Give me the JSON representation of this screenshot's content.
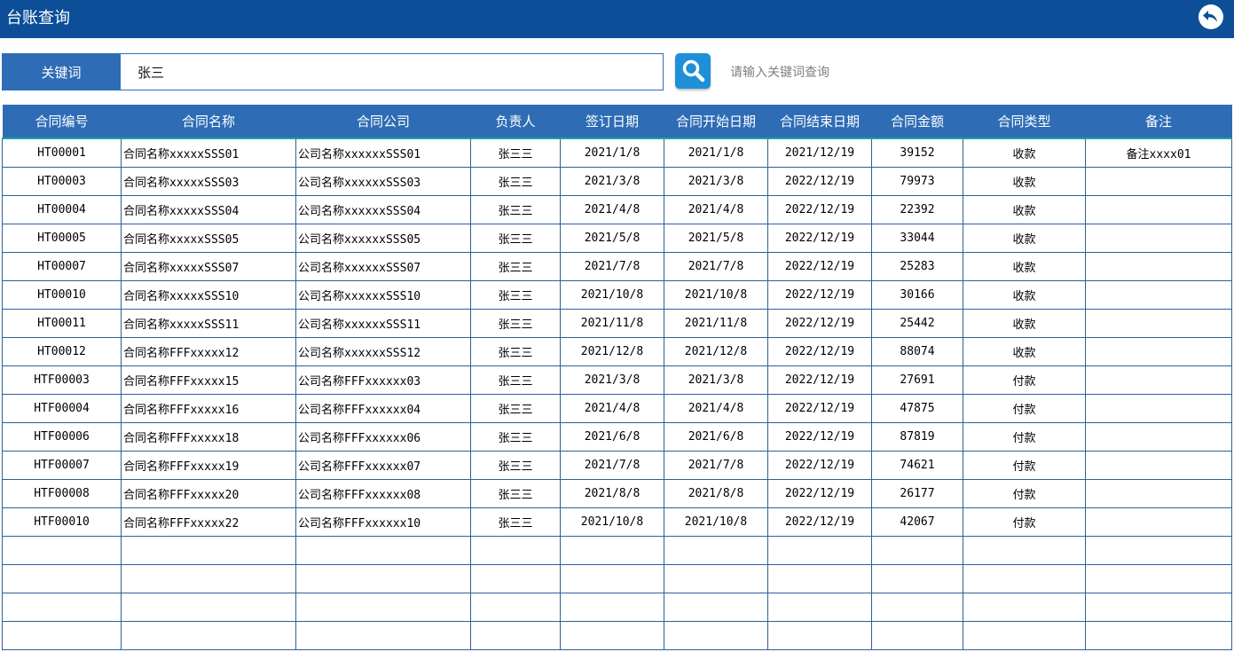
{
  "header": {
    "title": "台账查询",
    "back_icon": "back-arrow-icon"
  },
  "search": {
    "label": "关键词",
    "value": "张三",
    "hint": "请输入关键词查询",
    "button_icon": "search-icon",
    "button_color": "#1f8fd8"
  },
  "colors": {
    "header_bg": "#0c4f98",
    "table_header_bg": "#2e6db5",
    "grid_line": "#2e5f99"
  },
  "table": {
    "columns": [
      "合同编号",
      "合同名称",
      "合同公司",
      "负责人",
      "签订日期",
      "合同开始日期",
      "合同结束日期",
      "合同金额",
      "合同类型",
      "备注"
    ],
    "rows": [
      [
        "HT00001",
        "合同名称xxxxxSSS01",
        "公司名称xxxxxxSSS01",
        "张三三",
        "2021/1/8",
        "2021/1/8",
        "2021/12/19",
        "39152",
        "收款",
        "备注xxxx01"
      ],
      [
        "HT00003",
        "合同名称xxxxxSSS03",
        "公司名称xxxxxxSSS03",
        "张三三",
        "2021/3/8",
        "2021/3/8",
        "2022/12/19",
        "79973",
        "收款",
        ""
      ],
      [
        "HT00004",
        "合同名称xxxxxSSS04",
        "公司名称xxxxxxSSS04",
        "张三三",
        "2021/4/8",
        "2021/4/8",
        "2022/12/19",
        "22392",
        "收款",
        ""
      ],
      [
        "HT00005",
        "合同名称xxxxxSSS05",
        "公司名称xxxxxxSSS05",
        "张三三",
        "2021/5/8",
        "2021/5/8",
        "2022/12/19",
        "33044",
        "收款",
        ""
      ],
      [
        "HT00007",
        "合同名称xxxxxSSS07",
        "公司名称xxxxxxSSS07",
        "张三三",
        "2021/7/8",
        "2021/7/8",
        "2022/12/19",
        "25283",
        "收款",
        ""
      ],
      [
        "HT00010",
        "合同名称xxxxxSSS10",
        "公司名称xxxxxxSSS10",
        "张三三",
        "2021/10/8",
        "2021/10/8",
        "2022/12/19",
        "30166",
        "收款",
        ""
      ],
      [
        "HT00011",
        "合同名称xxxxxSSS11",
        "公司名称xxxxxxSSS11",
        "张三三",
        "2021/11/8",
        "2021/11/8",
        "2022/12/19",
        "25442",
        "收款",
        ""
      ],
      [
        "HT00012",
        "合同名称FFFxxxxx12",
        "公司名称xxxxxxSSS12",
        "张三三",
        "2021/12/8",
        "2021/12/8",
        "2022/12/19",
        "88074",
        "收款",
        ""
      ],
      [
        "HTF00003",
        "合同名称FFFxxxxx15",
        "公司名称FFFxxxxxx03",
        "张三三",
        "2021/3/8",
        "2021/3/8",
        "2022/12/19",
        "27691",
        "付款",
        ""
      ],
      [
        "HTF00004",
        "合同名称FFFxxxxx16",
        "公司名称FFFxxxxxx04",
        "张三三",
        "2021/4/8",
        "2021/4/8",
        "2022/12/19",
        "47875",
        "付款",
        ""
      ],
      [
        "HTF00006",
        "合同名称FFFxxxxx18",
        "公司名称FFFxxxxxx06",
        "张三三",
        "2021/6/8",
        "2021/6/8",
        "2022/12/19",
        "87819",
        "付款",
        ""
      ],
      [
        "HTF00007",
        "合同名称FFFxxxxx19",
        "公司名称FFFxxxxxx07",
        "张三三",
        "2021/7/8",
        "2021/7/8",
        "2022/12/19",
        "74621",
        "付款",
        ""
      ],
      [
        "HTF00008",
        "合同名称FFFxxxxx20",
        "公司名称FFFxxxxxx08",
        "张三三",
        "2021/8/8",
        "2021/8/8",
        "2022/12/19",
        "26177",
        "付款",
        ""
      ],
      [
        "HTF00010",
        "合同名称FFFxxxxx22",
        "公司名称FFFxxxxxx10",
        "张三三",
        "2021/10/8",
        "2021/10/8",
        "2022/12/19",
        "42067",
        "付款",
        ""
      ],
      [
        "",
        "",
        "",
        "",
        "",
        "",
        "",
        "",
        "",
        ""
      ],
      [
        "",
        "",
        "",
        "",
        "",
        "",
        "",
        "",
        "",
        ""
      ],
      [
        "",
        "",
        "",
        "",
        "",
        "",
        "",
        "",
        "",
        ""
      ],
      [
        "",
        "",
        "",
        "",
        "",
        "",
        "",
        "",
        "",
        ""
      ]
    ]
  }
}
